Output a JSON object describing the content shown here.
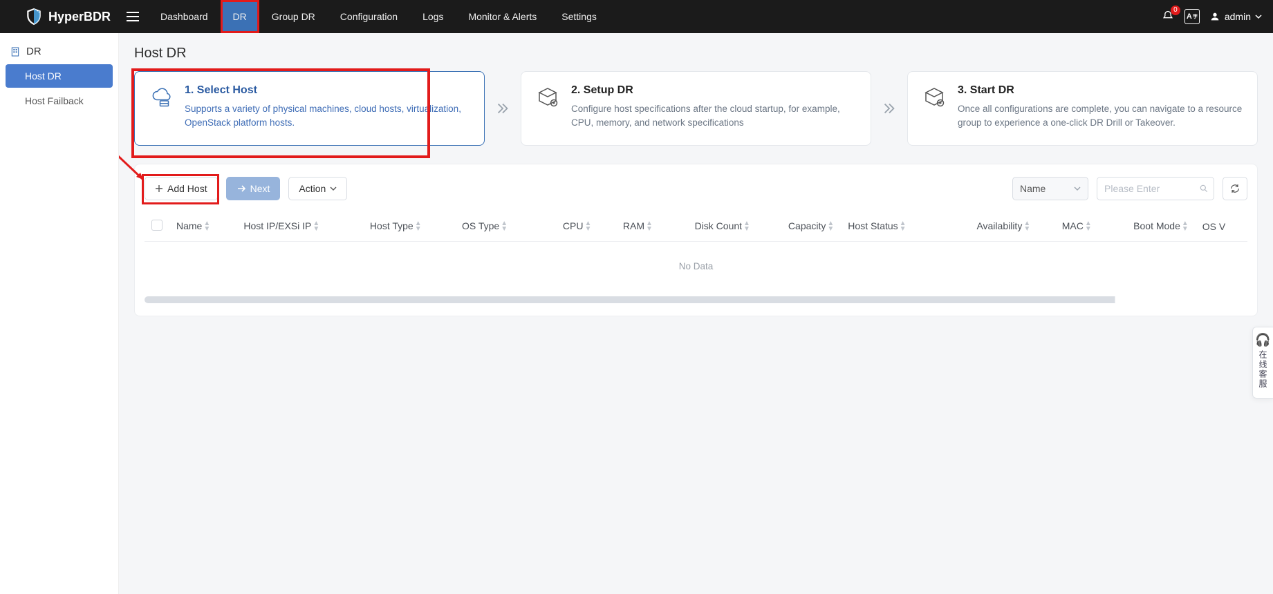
{
  "brand": {
    "name": "HyperBDR"
  },
  "topnav": {
    "items": [
      {
        "label": "Dashboard"
      },
      {
        "label": "DR",
        "active": true,
        "highlight": true
      },
      {
        "label": "Group DR"
      },
      {
        "label": "Configuration"
      },
      {
        "label": "Logs"
      },
      {
        "label": "Monitor & Alerts"
      },
      {
        "label": "Settings"
      }
    ]
  },
  "topright": {
    "notification_count": "0",
    "language_badge": "A",
    "username": "admin"
  },
  "sidebar": {
    "section": "DR",
    "items": [
      {
        "label": "Host DR",
        "active": true
      },
      {
        "label": "Host Failback"
      }
    ]
  },
  "page": {
    "title": "Host DR"
  },
  "steps": [
    {
      "title": "1. Select Host",
      "desc": "Supports a variety of physical machines, cloud hosts, virtualization, OpenStack platform hosts.",
      "active": true
    },
    {
      "title": "2. Setup DR",
      "desc": "Configure host specifications after the cloud startup, for example, CPU, memory, and network specifications"
    },
    {
      "title": "3. Start DR",
      "desc": "Once all configurations are complete, you can navigate to a resource group to experience a one-click DR Drill or Takeover."
    }
  ],
  "toolbar": {
    "add_label": "Add Host",
    "next_label": "Next",
    "action_label": "Action",
    "filter_field": "Name",
    "search_placeholder": "Please Enter"
  },
  "table": {
    "columns": [
      "Name",
      "Host IP/EXSi IP",
      "Host Type",
      "OS Type",
      "CPU",
      "RAM",
      "Disk Count",
      "Capacity",
      "Host Status",
      "Availability",
      "MAC",
      "Boot Mode",
      "OS V"
    ],
    "empty_text": "No Data"
  },
  "float_help": {
    "text": "在线客服"
  }
}
